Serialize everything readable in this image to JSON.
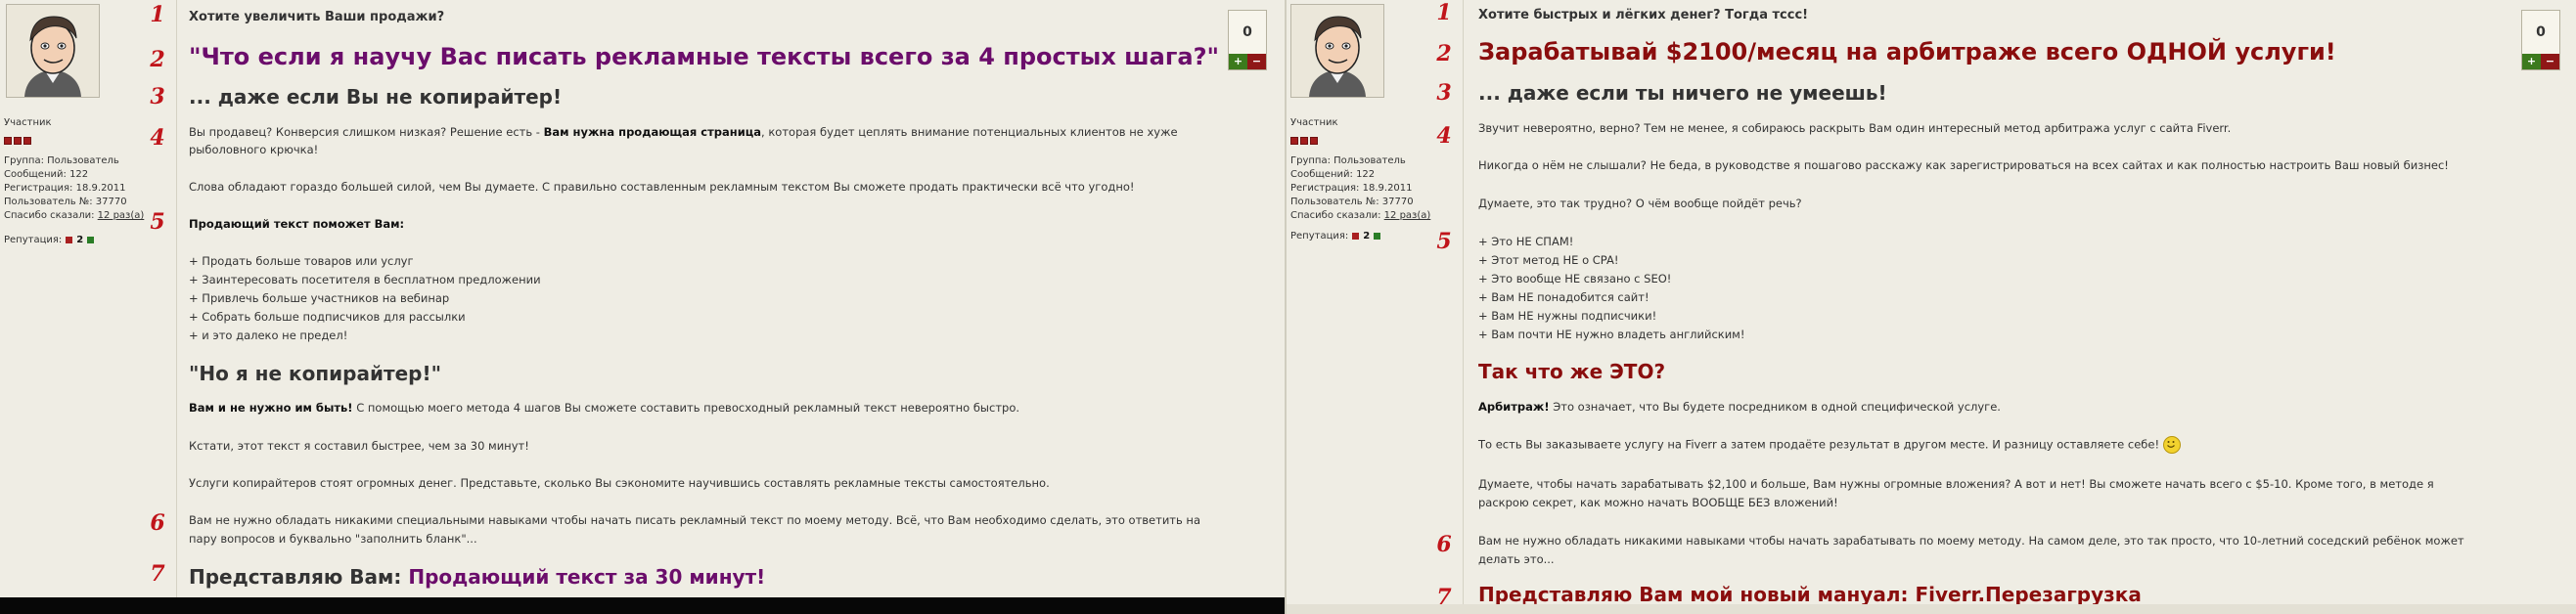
{
  "left": {
    "vote_count": "0",
    "vote_plus": "+",
    "vote_minus": "−",
    "role": "Участник",
    "info": [
      {
        "label": "Группа:",
        "value": "Пользователь"
      },
      {
        "label": "Сообщений:",
        "value": "122"
      },
      {
        "label": "Регистрация:",
        "value": "18.9.2011"
      },
      {
        "label": "Пользователь №:",
        "value": "37770"
      },
      {
        "label": "Спасибо сказали:",
        "value": "12 раз(а)"
      }
    ],
    "reputation_label": "Репутация:",
    "reputation_value": "2",
    "numbers": [
      "1",
      "2",
      "3",
      "4",
      "5",
      "6",
      "7"
    ],
    "question": "Хотите увеличить Ваши продажи?",
    "headline": "\"Что если я научу Вас писать рекламные тексты всего за 4 простых шага?\"",
    "subheadline": "... даже если Вы не копирайтер!",
    "p1_a": "Вы продавец? Конверсия слишком низкая? Решение есть - ",
    "p1_b": "Вам нужна продающая страница",
    "p1_c": ", которая будет цеплять внимание потенциальных клиентов не хуже",
    "p1_d": "рыболовного крючка!",
    "p2": "Слова обладают гораздо большей силой, чем Вы думаете. С правильно составленным рекламным текстом Вы сможете продать практически всё что угодно!",
    "bold_heading": "Продающий текст поможет Вам:",
    "list": [
      "+ Продать больше товаров или услуг",
      "+ Заинтересовать посетителя в бесплатном предложении",
      "+ Привлечь больше участников на вебинар",
      "+ Собрать больше подписчиков для рассылки",
      "+ и это далеко не предел!"
    ],
    "h2": "\"Но я не копирайтер!\"",
    "p3_a": "Вам и не нужно им быть!",
    "p3_b": " С помощью моего метода 4 шагов Вы сможете составить превосходный рекламный текст невероятно быстро.",
    "p4": "Кстати, этот текст я составил быстрее, чем за 30 минут!",
    "p5": "Услуги копирайтеров стоят огромных денег. Представьте, сколько Вы сэкономите научившись составлять рекламные тексты самостоятельно.",
    "p6_a": "Вам не нужно обладать никакими специальными навыками чтобы начать писать рекламный текст по моему методу. Всё, что Вам необходимо сделать, это ответить на",
    "p6_b": "пару вопросов и буквально \"заполнить бланк\"...",
    "final_a": "Представляю Вам: ",
    "final_b": "Продающий текст за 30 минут!"
  },
  "right": {
    "vote_count": "0",
    "vote_plus": "+",
    "vote_minus": "−",
    "role": "Участник",
    "info": [
      {
        "label": "Группа:",
        "value": "Пользователь"
      },
      {
        "label": "Сообщений:",
        "value": "122"
      },
      {
        "label": "Регистрация:",
        "value": "18.9.2011"
      },
      {
        "label": "Пользователь №:",
        "value": "37770"
      },
      {
        "label": "Спасибо сказали:",
        "value": "12 раз(а)"
      }
    ],
    "reputation_label": "Репутация:",
    "reputation_value": "2",
    "numbers": [
      "1",
      "2",
      "3",
      "4",
      "5",
      "6",
      "7"
    ],
    "question": "Хотите быстрых и лёгких денег? Тогда тссс!",
    "headline": "Зарабатывай $2100/месяц на арбитраже всего ОДНОЙ услуги!",
    "subheadline": "... даже если ты ничего не умеешь!",
    "p1": "Звучит невероятно, верно? Тем не менее, я собираюсь раскрыть Вам один интересный метод арбитража услуг с сайта Fiverr.",
    "p2": "Никогда о нём не слышали? Не беда, в руководстве я пошагово расскажу как зарегистрироваться на всех сайтах и как полностью настроить Ваш новый бизнес!",
    "p3": "Думаете, это так трудно? О чём вообще пойдёт речь?",
    "list": [
      "+ Это НЕ СПАМ!",
      "+ Этот метод НЕ о CPA!",
      "+ Это вообще НЕ связано с SEO!",
      "+ Вам НЕ понадобится сайт!",
      "+ Вам НЕ нужны подписчики!",
      "+ Вам почти НЕ нужно владеть английским!"
    ],
    "h2": "Так что же ЭТО?",
    "p4_a": "Арбитраж!",
    "p4_b": " Это означает, что Вы будете посредником в одной специфической услуге.",
    "p5": "То есть Вы заказываете услугу на Fiverr а затем продаёте результат в другом месте. И разницу оставляете себе!",
    "p6_a": "Думаете, чтобы начать зарабатывать $2,100 и больше, Вам нужны огромные вложения? А вот и нет! Вы сможете начать всего с $5-10. Кроме того, в методе я",
    "p6_b": "раскрою секрет, как можно начать ВООБЩЕ БЕЗ вложений!",
    "p7_a": "Вам не нужно обладать никакими навыками чтобы начать зарабатывать по моему методу. На самом деле, это так просто, что 10-летний соседский ребёнок может",
    "p7_b": "делать это...",
    "final": "Представляю Вам мой новый мануал: Fiverr.Перезагрузка"
  }
}
